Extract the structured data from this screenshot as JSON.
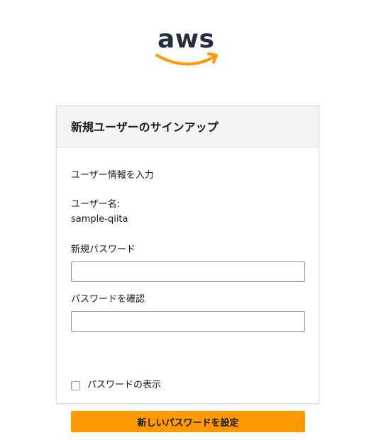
{
  "logo": {
    "text": "aws"
  },
  "form": {
    "title": "新規ユーザーのサインアップ",
    "intro": "ユーザー情報を入力",
    "username_label": "ユーザー名:",
    "username_value": "sample-qiita",
    "new_password_label": "新規パスワード",
    "new_password_value": "",
    "confirm_password_label": "パスワードを確認",
    "confirm_password_value": "",
    "show_password_label": "パスワードの表示",
    "submit_label": "新しいパスワードを設定"
  },
  "colors": {
    "brand_dark": "#232f3e",
    "brand_orange": "#ff9900"
  }
}
